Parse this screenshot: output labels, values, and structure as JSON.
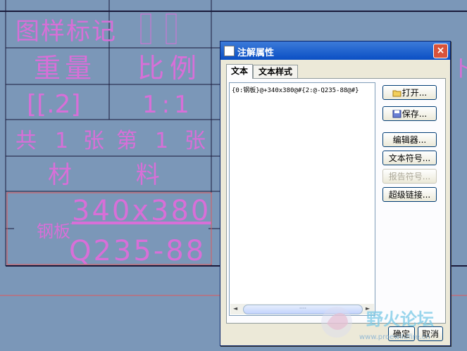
{
  "drawing": {
    "title_block": {
      "label_drawing_mark": "图样标记",
      "mark_cells": [
        "",
        "",
        ""
      ],
      "label_weight": "重量",
      "label_scale": "比例",
      "weight_value": "[[.2]",
      "scale_value": "1:1",
      "sheet_info": [
        "共",
        "1",
        "张",
        "第",
        "1",
        "张"
      ],
      "label_material": "材 料",
      "material_name": "钢板",
      "material_size": "340x380",
      "material_grade": "Q235-88"
    },
    "edge_partial_text": "卜"
  },
  "dialog": {
    "title": "注解属性",
    "close_label": "×",
    "tabs": [
      {
        "label": "文本"
      },
      {
        "label": "文本样式"
      }
    ],
    "text_content": "{0:钢板}@+340x380@#{2:@-Q235-88@#}",
    "scroll_grip": "····",
    "scroll_left": "◄",
    "scroll_right": "►",
    "buttons": {
      "open": "打开...",
      "save": "保存...",
      "editor": "编辑器...",
      "text_symbol": "文本符号...",
      "report_symbol": "报告符号...",
      "hyperlink": "超级链接..."
    },
    "ok": "确定",
    "cancel": "取消"
  },
  "watermark": {
    "text": "野火论坛",
    "url": "www.proewildfire.cn"
  },
  "colors": {
    "background": "#7b97b8",
    "drawing_line": "#1a1a3a",
    "drawing_text": "#d86fd8",
    "highlight_box": "#e05a5a",
    "title_bar": "#0a4fc4"
  }
}
